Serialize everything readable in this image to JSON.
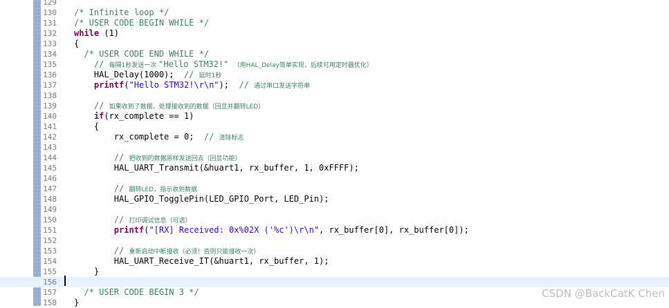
{
  "editor": {
    "current_line": 156,
    "lines": [
      {
        "n": 129,
        "tokens": []
      },
      {
        "n": 130,
        "tokens": [
          {
            "t": "c",
            "s": "/* Infinite loop */"
          }
        ]
      },
      {
        "n": 131,
        "tokens": [
          {
            "t": "c",
            "s": "/* USER CODE BEGIN WHILE */"
          }
        ]
      },
      {
        "n": 132,
        "tokens": [
          {
            "t": "k",
            "s": "while"
          },
          {
            "t": "p",
            "s": " (1)"
          }
        ]
      },
      {
        "n": 133,
        "tokens": [
          {
            "t": "p",
            "s": "{"
          }
        ]
      },
      {
        "n": 134,
        "tokens": [
          {
            "t": "c",
            "s": "  /* USER CODE END WHILE */"
          }
        ]
      },
      {
        "n": 135,
        "tokens": [
          {
            "t": "c",
            "s": "    // "
          },
          {
            "t": "cz",
            "s": "每隔1秒发送一次 "
          },
          {
            "t": "c",
            "s": "\"Hello STM32!\" "
          },
          {
            "t": "cz",
            "s": "（用HAL_Delay简单实现，后续可用定时器优化）"
          }
        ]
      },
      {
        "n": 136,
        "tokens": [
          {
            "t": "p",
            "s": "    HAL_Delay(1000);  "
          },
          {
            "t": "c",
            "s": "// "
          },
          {
            "t": "cz",
            "s": "延时1秒"
          }
        ]
      },
      {
        "n": 137,
        "tokens": [
          {
            "t": "k",
            "s": "    printf"
          },
          {
            "t": "p",
            "s": "("
          },
          {
            "t": "s",
            "s": "\"Hello STM32!\\r\\n\""
          },
          {
            "t": "p",
            "s": ");  "
          },
          {
            "t": "c",
            "s": "// "
          },
          {
            "t": "cz",
            "s": "通过串口发送字符串"
          }
        ]
      },
      {
        "n": 138,
        "tokens": []
      },
      {
        "n": 139,
        "tokens": [
          {
            "t": "c",
            "s": "    // "
          },
          {
            "t": "cz",
            "s": "如果收到了数据，处理接收到的数据（回显并翻转LED）"
          }
        ]
      },
      {
        "n": 140,
        "tokens": [
          {
            "t": "k",
            "s": "    if"
          },
          {
            "t": "p",
            "s": "(rx_complete == 1)"
          }
        ]
      },
      {
        "n": 141,
        "tokens": [
          {
            "t": "p",
            "s": "    {"
          }
        ]
      },
      {
        "n": 142,
        "tokens": [
          {
            "t": "p",
            "s": "        rx_complete = 0;  "
          },
          {
            "t": "c",
            "s": "// "
          },
          {
            "t": "cz",
            "s": "清除标志"
          }
        ]
      },
      {
        "n": 143,
        "tokens": []
      },
      {
        "n": 144,
        "tokens": [
          {
            "t": "c",
            "s": "        // "
          },
          {
            "t": "cz",
            "s": "把收到的数据原样发送回去（回显功能）"
          }
        ]
      },
      {
        "n": 145,
        "tokens": [
          {
            "t": "p",
            "s": "        HAL_UART_Transmit(&huart1, rx_buffer, 1, 0xFFFF);"
          }
        ]
      },
      {
        "n": 146,
        "tokens": []
      },
      {
        "n": 147,
        "tokens": [
          {
            "t": "c",
            "s": "        // "
          },
          {
            "t": "cz",
            "s": "翻转LED，指示收到数据"
          }
        ]
      },
      {
        "n": 148,
        "tokens": [
          {
            "t": "p",
            "s": "        HAL_GPIO_TogglePin(LED_GPIO_Port, LED_Pin);"
          }
        ]
      },
      {
        "n": 149,
        "tokens": []
      },
      {
        "n": 150,
        "tokens": [
          {
            "t": "c",
            "s": "        // "
          },
          {
            "t": "cz",
            "s": "打印调试信息（可选）"
          }
        ]
      },
      {
        "n": 151,
        "tokens": [
          {
            "t": "k",
            "s": "        printf"
          },
          {
            "t": "p",
            "s": "("
          },
          {
            "t": "s",
            "s": "\"[RX] Received: 0x%02X ('%c')\\r\\n\""
          },
          {
            "t": "p",
            "s": ", rx_buffer[0], rx_buffer[0]);"
          }
        ]
      },
      {
        "n": 152,
        "tokens": []
      },
      {
        "n": 153,
        "tokens": [
          {
            "t": "c",
            "s": "        // "
          },
          {
            "t": "cz",
            "s": "重新启动中断接收（必须！否则只能接收一次）"
          }
        ]
      },
      {
        "n": 154,
        "tokens": [
          {
            "t": "p",
            "s": "        HAL_UART_Receive_IT(&huart1, rx_buffer, 1);"
          }
        ]
      },
      {
        "n": 155,
        "tokens": [
          {
            "t": "p",
            "s": "    }"
          }
        ]
      },
      {
        "n": 156,
        "tokens": []
      },
      {
        "n": 157,
        "tokens": [
          {
            "t": "c",
            "s": "  /* USER CODE BEGIN 3 */"
          }
        ]
      },
      {
        "n": 158,
        "tokens": [
          {
            "t": "p",
            "s": "}"
          }
        ]
      }
    ]
  },
  "watermark": "CSDN @BackCatK Chen"
}
